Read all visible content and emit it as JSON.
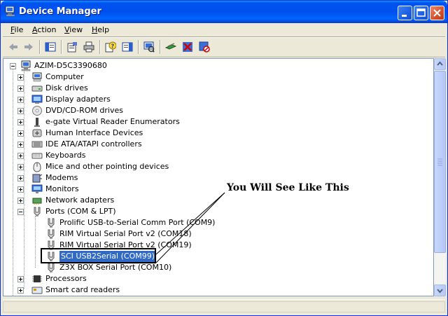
{
  "window": {
    "title": "Device Manager"
  },
  "menu": [
    {
      "label": "File",
      "u": "F",
      "rest": "ile"
    },
    {
      "label": "Action",
      "u": "A",
      "rest": "ction"
    },
    {
      "label": "View",
      "u": "V",
      "rest": "iew"
    },
    {
      "label": "Help",
      "u": "H",
      "rest": "elp"
    }
  ],
  "tree": {
    "root": "AZIM-D5C3390680",
    "categories": [
      "Computer",
      "Disk drives",
      "Display adapters",
      "DVD/CD-ROM drives",
      "e-gate Virtual Reader Enumerators",
      "Human Interface Devices",
      "IDE ATA/ATAPI controllers",
      "Keyboards",
      "Mice and other pointing devices",
      "Modems",
      "Monitors",
      "Network adapters",
      "Ports (COM & LPT)"
    ],
    "ports": [
      "Prolific USB-to-Serial Comm Port (COM9)",
      "RIM Virtual Serial Port v2 (COM18)",
      "RIM Virtual Serial Port v2 (COM19)",
      "SCI USB2Serial (COM99)",
      "Z3X BOX Serial Port (COM10)"
    ],
    "after": [
      "Processors",
      "Smart card readers"
    ]
  },
  "annotation": {
    "text": "You Will See Like This"
  },
  "colors": {
    "titlebar": "#0054e3",
    "selection": "#316ac5",
    "window_bg": "#ece9d8"
  }
}
